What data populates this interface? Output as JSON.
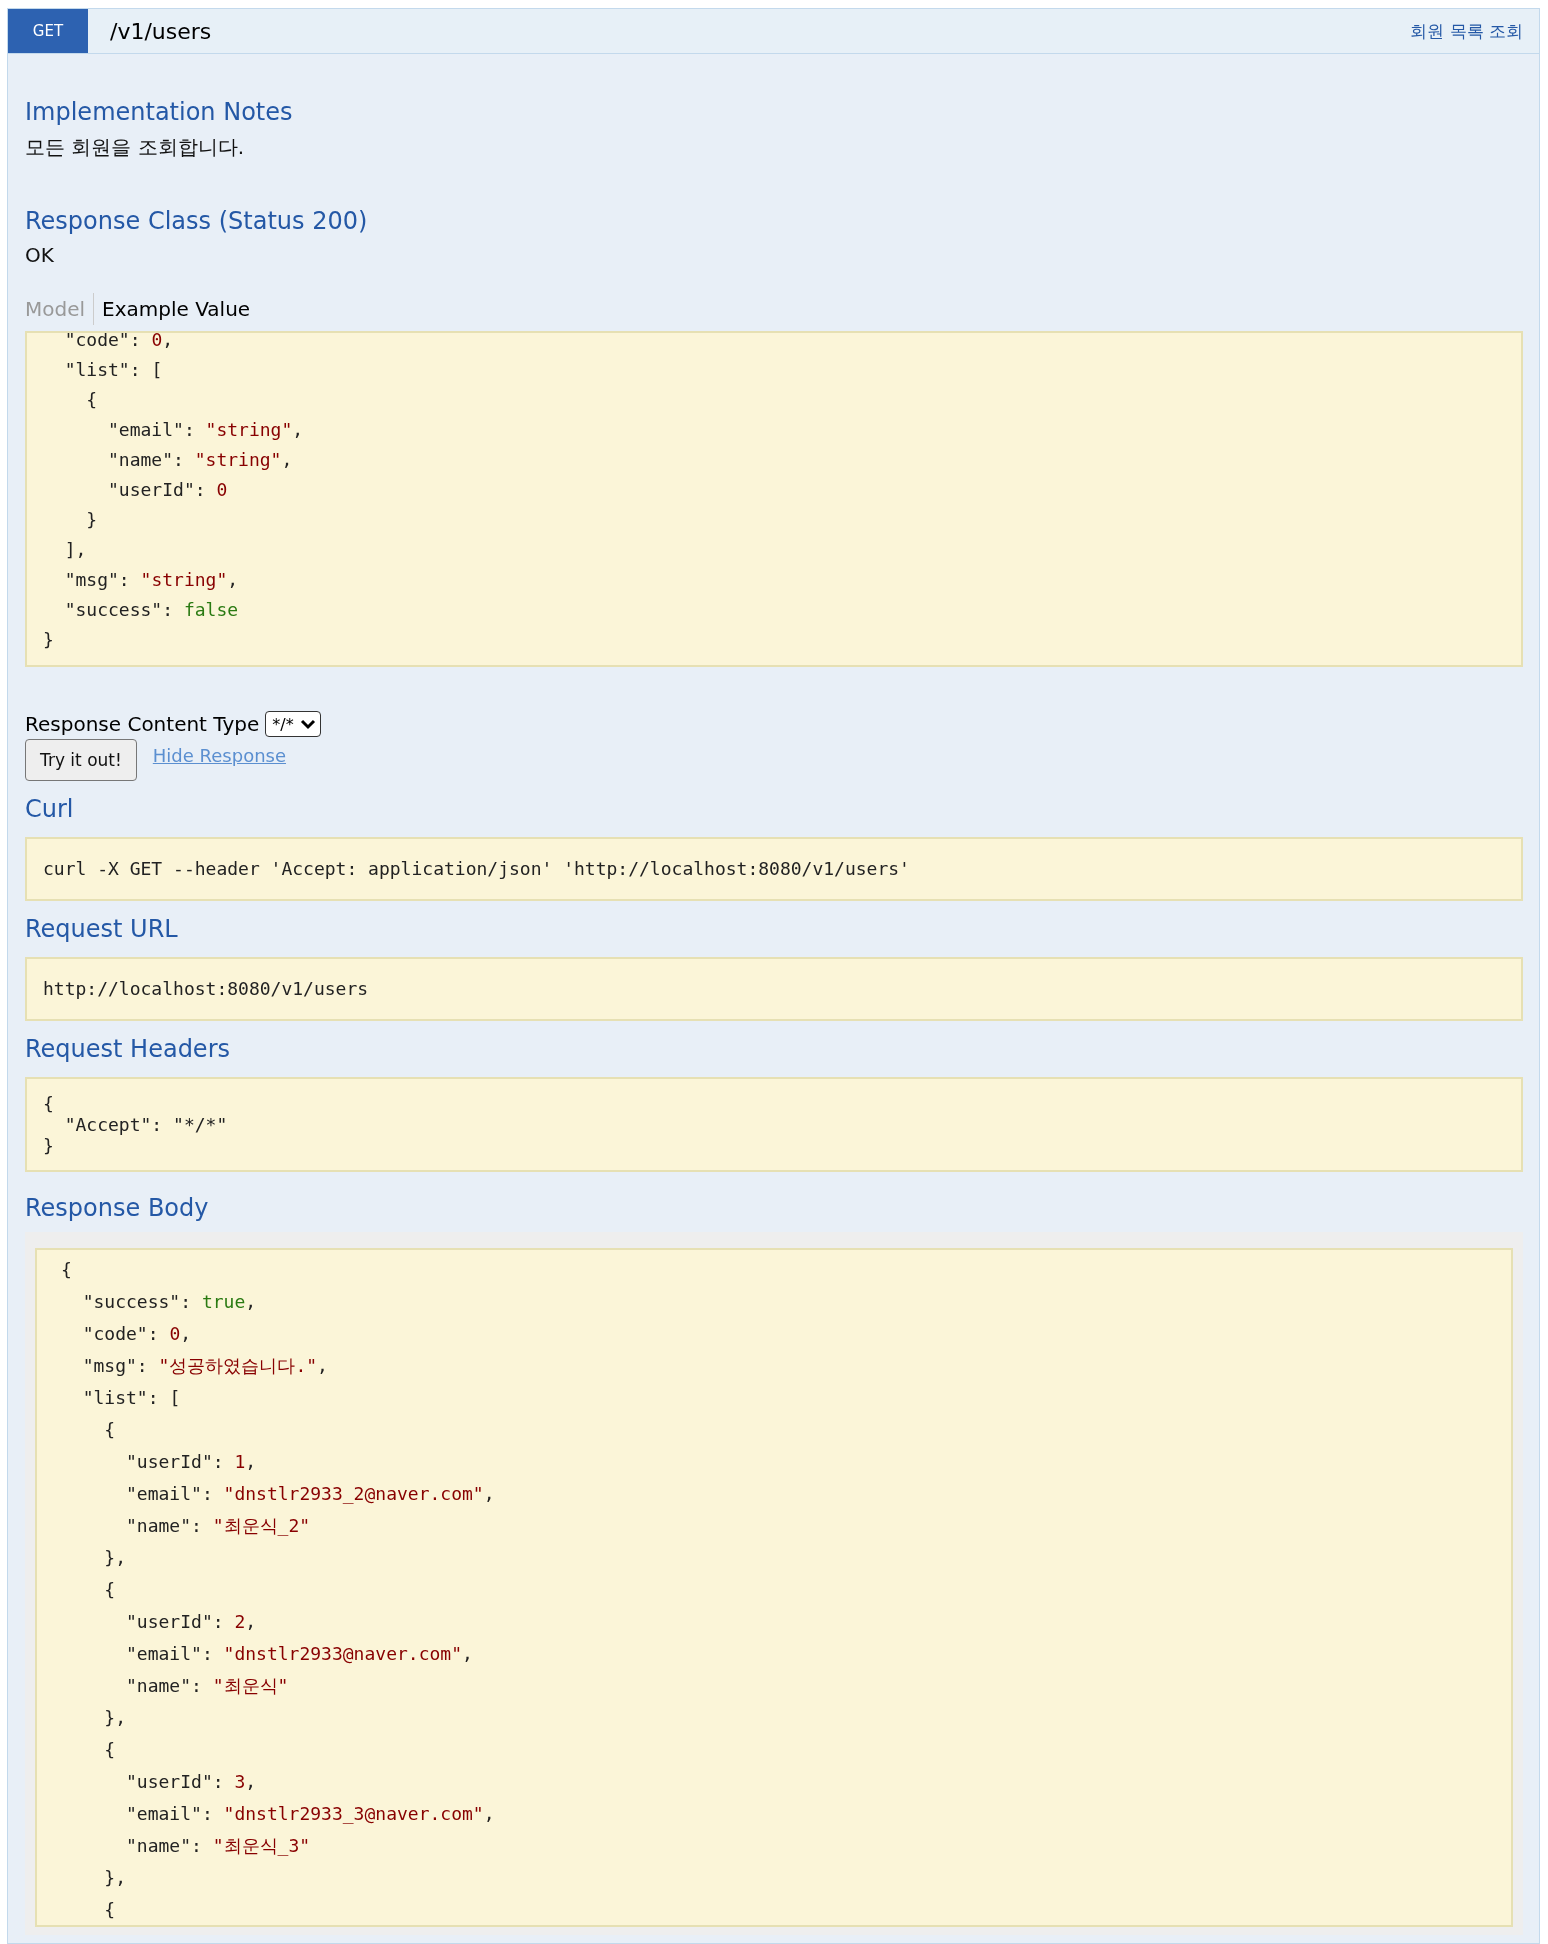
{
  "operation": {
    "method": "GET",
    "path": "/v1/users",
    "summary": "회원 목록 조회"
  },
  "implementation_notes": {
    "title": "Implementation Notes",
    "text": "모든 회원을 조회합니다."
  },
  "response_class": {
    "title": "Response Class (Status 200)",
    "text": "OK"
  },
  "model_tabs": [
    {
      "label": "Model",
      "selected": false
    },
    {
      "label": "Example Value",
      "selected": true
    }
  ],
  "example_value": [
    [
      {
        "kind": "key",
        "text": "  \"code\""
      },
      {
        "kind": "plain",
        "text": ": "
      },
      {
        "kind": "number",
        "text": "0"
      },
      {
        "kind": "plain",
        "text": ","
      }
    ],
    [
      {
        "kind": "key",
        "text": "  \"list\""
      },
      {
        "kind": "plain",
        "text": ": ["
      }
    ],
    [
      {
        "kind": "plain",
        "text": "    {"
      }
    ],
    [
      {
        "kind": "key",
        "text": "      \"email\""
      },
      {
        "kind": "plain",
        "text": ": "
      },
      {
        "kind": "string",
        "text": "\"string\""
      },
      {
        "kind": "plain",
        "text": ","
      }
    ],
    [
      {
        "kind": "key",
        "text": "      \"name\""
      },
      {
        "kind": "plain",
        "text": ": "
      },
      {
        "kind": "string",
        "text": "\"string\""
      },
      {
        "kind": "plain",
        "text": ","
      }
    ],
    [
      {
        "kind": "key",
        "text": "      \"userId\""
      },
      {
        "kind": "plain",
        "text": ": "
      },
      {
        "kind": "number",
        "text": "0"
      }
    ],
    [
      {
        "kind": "plain",
        "text": "    }"
      }
    ],
    [
      {
        "kind": "plain",
        "text": "  ],"
      }
    ],
    [
      {
        "kind": "key",
        "text": "  \"msg\""
      },
      {
        "kind": "plain",
        "text": ": "
      },
      {
        "kind": "string",
        "text": "\"string\""
      },
      {
        "kind": "plain",
        "text": ","
      }
    ],
    [
      {
        "kind": "key",
        "text": "  \"success\""
      },
      {
        "kind": "plain",
        "text": ": "
      },
      {
        "kind": "bool",
        "text": "false"
      }
    ],
    [
      {
        "kind": "plain",
        "text": "}"
      }
    ]
  ],
  "content_type": {
    "label": "Response Content Type",
    "value": "*/*"
  },
  "try_button": "Try it out!",
  "hide_link": "Hide Response",
  "curl": {
    "title": "Curl",
    "text": "curl -X GET --header 'Accept: application/json' 'http://localhost:8080/v1/users'"
  },
  "request_url": {
    "title": "Request URL",
    "text": "http://localhost:8080/v1/users"
  },
  "request_headers": {
    "title": "Request Headers",
    "lines": [
      "{",
      "  \"Accept\": \"*/*\"",
      "}"
    ]
  },
  "response_body": {
    "title": "Response Body",
    "lines": [
      [
        {
          "kind": "plain",
          "text": "{"
        }
      ],
      [
        {
          "kind": "key",
          "text": "  \"success\""
        },
        {
          "kind": "plain",
          "text": ": "
        },
        {
          "kind": "bool",
          "text": "true"
        },
        {
          "kind": "plain",
          "text": ","
        }
      ],
      [
        {
          "kind": "key",
          "text": "  \"code\""
        },
        {
          "kind": "plain",
          "text": ": "
        },
        {
          "kind": "number",
          "text": "0"
        },
        {
          "kind": "plain",
          "text": ","
        }
      ],
      [
        {
          "kind": "key",
          "text": "  \"msg\""
        },
        {
          "kind": "plain",
          "text": ": "
        },
        {
          "kind": "string",
          "text": "\"성공하였습니다.\""
        },
        {
          "kind": "plain",
          "text": ","
        }
      ],
      [
        {
          "kind": "key",
          "text": "  \"list\""
        },
        {
          "kind": "plain",
          "text": ": ["
        }
      ],
      [
        {
          "kind": "plain",
          "text": "    {"
        }
      ],
      [
        {
          "kind": "key",
          "text": "      \"userId\""
        },
        {
          "kind": "plain",
          "text": ": "
        },
        {
          "kind": "number",
          "text": "1"
        },
        {
          "kind": "plain",
          "text": ","
        }
      ],
      [
        {
          "kind": "key",
          "text": "      \"email\""
        },
        {
          "kind": "plain",
          "text": ": "
        },
        {
          "kind": "string",
          "text": "\"dnstlr2933_2@naver.com\""
        },
        {
          "kind": "plain",
          "text": ","
        }
      ],
      [
        {
          "kind": "key",
          "text": "      \"name\""
        },
        {
          "kind": "plain",
          "text": ": "
        },
        {
          "kind": "string",
          "text": "\"최운식_2\""
        }
      ],
      [
        {
          "kind": "plain",
          "text": "    },"
        }
      ],
      [
        {
          "kind": "plain",
          "text": "    {"
        }
      ],
      [
        {
          "kind": "key",
          "text": "      \"userId\""
        },
        {
          "kind": "plain",
          "text": ": "
        },
        {
          "kind": "number",
          "text": "2"
        },
        {
          "kind": "plain",
          "text": ","
        }
      ],
      [
        {
          "kind": "key",
          "text": "      \"email\""
        },
        {
          "kind": "plain",
          "text": ": "
        },
        {
          "kind": "string",
          "text": "\"dnstlr2933@naver.com\""
        },
        {
          "kind": "plain",
          "text": ","
        }
      ],
      [
        {
          "kind": "key",
          "text": "      \"name\""
        },
        {
          "kind": "plain",
          "text": ": "
        },
        {
          "kind": "string",
          "text": "\"최운식\""
        }
      ],
      [
        {
          "kind": "plain",
          "text": "    },"
        }
      ],
      [
        {
          "kind": "plain",
          "text": "    {"
        }
      ],
      [
        {
          "kind": "key",
          "text": "      \"userId\""
        },
        {
          "kind": "plain",
          "text": ": "
        },
        {
          "kind": "number",
          "text": "3"
        },
        {
          "kind": "plain",
          "text": ","
        }
      ],
      [
        {
          "kind": "key",
          "text": "      \"email\""
        },
        {
          "kind": "plain",
          "text": ": "
        },
        {
          "kind": "string",
          "text": "\"dnstlr2933_3@naver.com\""
        },
        {
          "kind": "plain",
          "text": ","
        }
      ],
      [
        {
          "kind": "key",
          "text": "      \"name\""
        },
        {
          "kind": "plain",
          "text": ": "
        },
        {
          "kind": "string",
          "text": "\"최운식_3\""
        }
      ],
      [
        {
          "kind": "plain",
          "text": "    },"
        }
      ],
      [
        {
          "kind": "plain",
          "text": "    {"
        }
      ]
    ]
  }
}
